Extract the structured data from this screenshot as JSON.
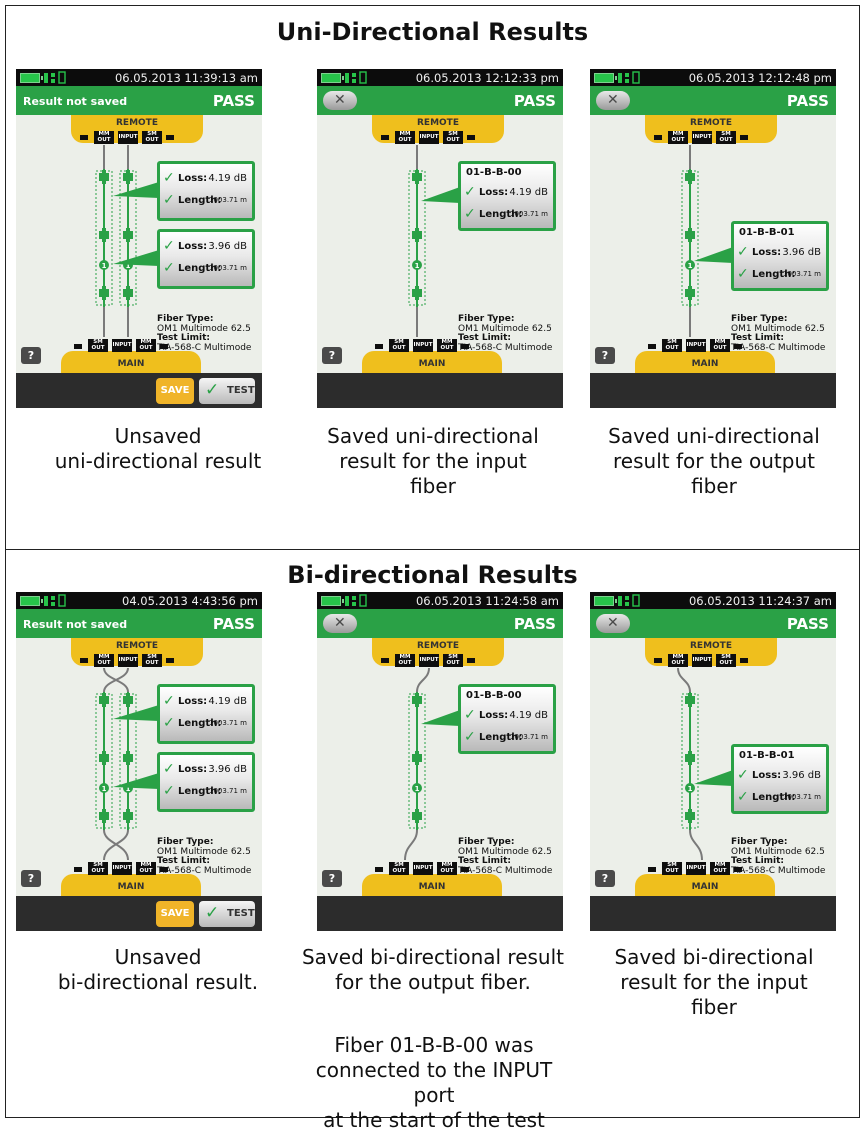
{
  "sections": {
    "uni": {
      "title": "Uni-Directional Results"
    },
    "bi": {
      "title": "Bi-directional Results"
    }
  },
  "common": {
    "pass": "PASS",
    "result_not_saved": "Result not saved",
    "remote_label": "REMOTE",
    "main_label": "MAIN",
    "port_mm_out": "MM OUT",
    "port_input": "INPUT",
    "port_sm_out": "SM OUT",
    "loss_label": "Loss:",
    "length_label": "Length:",
    "fiber_type_label": "Fiber Type:",
    "fiber_type_value": "OM1 Multimode 62.5",
    "test_limit_label": "Test Limit:",
    "test_limit_value": "TIA-568-C Multimode",
    "save_label": "SAVE",
    "test_label": "TEST",
    "help_label": "?",
    "back_label": "✕",
    "icons": [
      "battery-icon",
      "network-icon",
      "check-icon",
      "help-icon",
      "back-icon"
    ],
    "colors": {
      "green": "#2aa146",
      "yellow": "#efbf1d",
      "dark": "#2c2c2c"
    }
  },
  "screens": {
    "u1": {
      "time": "06.05.2013 11:39:13 am",
      "loss1": "4.19 dB",
      "len1": "1003.71 m",
      "loss2": "3.96 dB",
      "len2": "1003.71 m",
      "caption_l1": "Unsaved",
      "caption_l2": "uni-directional result"
    },
    "u2": {
      "time": "06.05.2013 12:12:33 pm",
      "name": "01-B-B-00",
      "loss": "4.19 dB",
      "len": "1003.71 m",
      "caption_l1": "Saved uni-directional",
      "caption_l2": "result for the input",
      "caption_l3": "fiber"
    },
    "u3": {
      "time": "06.05.2013 12:12:48 pm",
      "name": "01-B-B-01",
      "loss": "3.96 dB",
      "len": "1003.71 m",
      "caption_l1": "Saved uni-directional",
      "caption_l2": "result for the output",
      "caption_l3": "fiber"
    },
    "b1": {
      "time": "04.05.2013 4:43:56 pm",
      "loss1": "4.19 dB",
      "len1": "1003.71 m",
      "loss2": "3.96 dB",
      "len2": "1003.71 m",
      "caption_l1": "Unsaved",
      "caption_l2": "bi-directional result."
    },
    "b2": {
      "time": "06.05.2013 11:24:58 am",
      "name": "01-B-B-00",
      "loss": "4.19 dB",
      "len": "1003.71 m",
      "caption_l1": "Saved bi-directional result",
      "caption_l2": "for the output fiber."
    },
    "b3": {
      "time": "06.05.2013 11:24:37 am",
      "name": "01-B-B-01",
      "loss": "3.96 dB",
      "len": "1003.71 m",
      "caption_l1": "Saved bi-directional",
      "caption_l2": "result for the input",
      "caption_l3": "fiber"
    }
  },
  "note": {
    "l1": "Fiber 01-B-B-00 was",
    "l2": "connected to the INPUT port",
    "l3": "at the start of the test"
  }
}
